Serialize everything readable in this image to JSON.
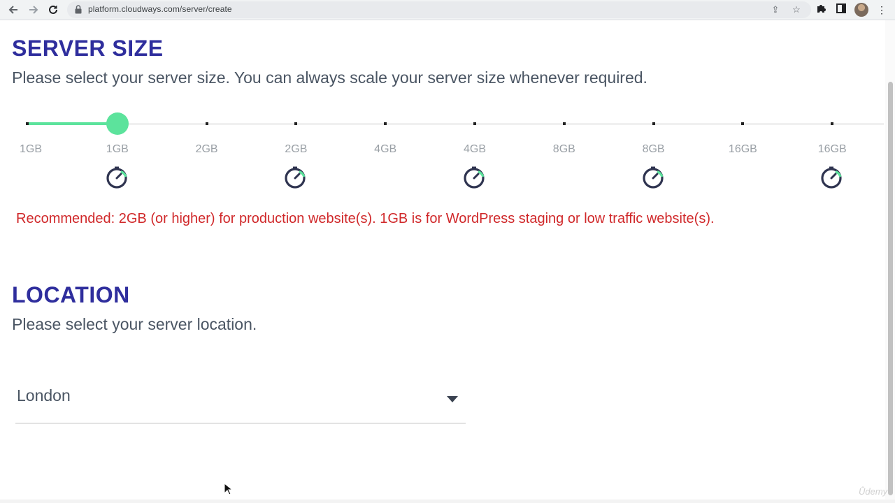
{
  "browser": {
    "url": "platform.cloudways.com/server/create"
  },
  "server_size": {
    "title": "SERVER SIZE",
    "description": "Please select your server size. You can always scale your server size whenever required.",
    "selected_index": 1,
    "stops": [
      {
        "label": "1GB",
        "icon": false
      },
      {
        "label": "1GB",
        "icon": true
      },
      {
        "label": "2GB",
        "icon": false
      },
      {
        "label": "2GB",
        "icon": true
      },
      {
        "label": "4GB",
        "icon": false
      },
      {
        "label": "4GB",
        "icon": true
      },
      {
        "label": "8GB",
        "icon": false
      },
      {
        "label": "8GB",
        "icon": true
      },
      {
        "label": "16GB",
        "icon": false
      },
      {
        "label": "16GB",
        "icon": true
      }
    ],
    "recommendation": "Recommended: 2GB (or higher) for production website(s). 1GB is for WordPress staging or low traffic website(s)."
  },
  "location": {
    "title": "LOCATION",
    "description": "Please select your server location.",
    "selected": "London"
  },
  "watermark": "Ûdemy",
  "colors": {
    "heading": "#2f2e9d",
    "accent": "#5ce39c",
    "warning": "#d0282a"
  },
  "icons": {
    "back": "arrow-left-icon",
    "forward": "arrow-right-icon",
    "reload": "reload-icon",
    "lock": "lock-icon",
    "share": "share-icon",
    "bookmark": "star-icon",
    "extensions": "puzzle-icon",
    "sidepanel": "sidepanel-icon",
    "menu": "kebab-menu-icon",
    "speed": "speedometer-icon",
    "caret": "caret-down-icon"
  }
}
